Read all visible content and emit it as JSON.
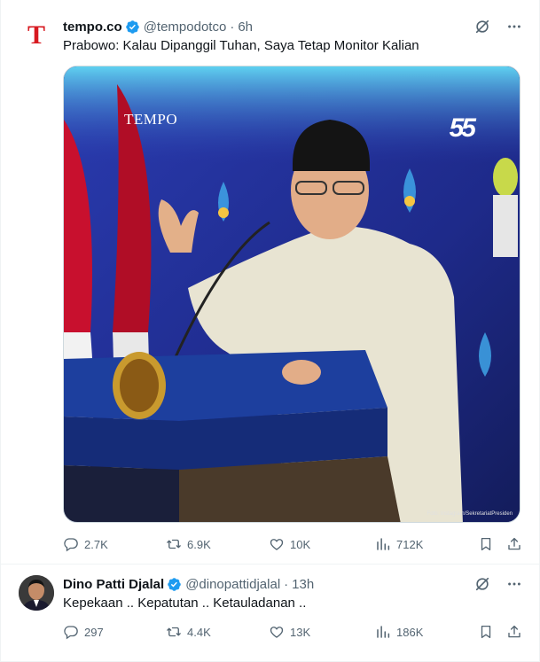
{
  "tweets": [
    {
      "name": "tempo.co",
      "handle": "@tempodotco",
      "separator": "·",
      "time": "6h",
      "text": "Prabowo: Kalau Dipanggil Tuhan, Saya Tetap Monitor Kalian",
      "avatar_letter": "T",
      "media": {
        "watermark": "TEMPO",
        "badge": "55",
        "credit": "Foto: Instagram/SekretariatPresiden"
      },
      "stats": {
        "replies": "2.7K",
        "reposts": "6.9K",
        "likes": "10K",
        "views": "712K"
      }
    },
    {
      "name": "Dino Patti Djalal",
      "handle": "@dinopattidjalal",
      "separator": "·",
      "time": "13h",
      "text": "Kepekaan .. Kepatutan .. Ketauladanan ..",
      "stats": {
        "replies": "297",
        "reposts": "4.4K",
        "likes": "13K",
        "views": "186K"
      }
    }
  ],
  "icons": {
    "verified": "verified-badge-icon",
    "grok": "grok-icon",
    "more": "more-icon",
    "reply": "reply-icon",
    "repost": "repost-icon",
    "like": "like-icon",
    "views": "views-icon",
    "bookmark": "bookmark-icon",
    "share": "share-icon"
  },
  "colors": {
    "text_primary": "#0f1419",
    "text_secondary": "#536471",
    "verified_blue": "#1d9bf0",
    "divider": "#eff3f4",
    "tempo_red": "#d71920"
  }
}
